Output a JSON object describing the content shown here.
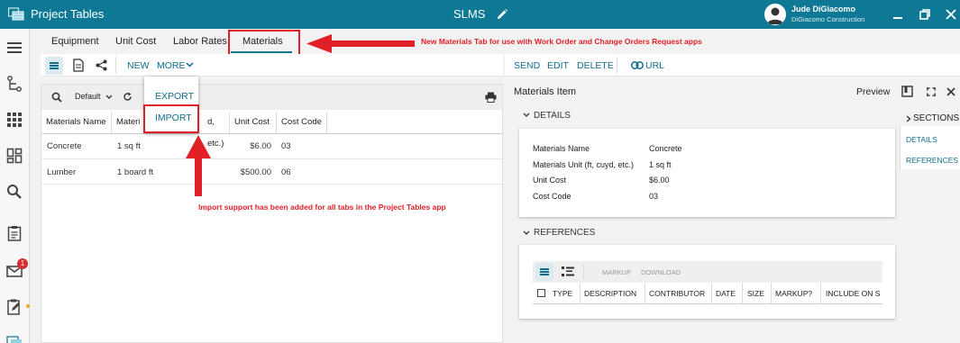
{
  "app": {
    "title": "Project Tables",
    "center_title": "SLMS"
  },
  "user": {
    "name": "Jude DiGiacomo",
    "company": "DiGiacomo Construction"
  },
  "rail": {
    "mail_badge": "1"
  },
  "tabs": [
    {
      "label": "Equipment"
    },
    {
      "label": "Unit Cost"
    },
    {
      "label": "Labor Rates"
    },
    {
      "label": "Materials"
    }
  ],
  "annotations": {
    "tab_note": "New Materials Tab for use with Work Order and Change Orders Request apps",
    "import_note": "Import support has been added for all tabs in the Project Tables app"
  },
  "toolbar": {
    "new_label": "NEW",
    "more_label": "MORE"
  },
  "dropdown": {
    "export_label": "EXPORT",
    "import_label": "IMPORT"
  },
  "grid": {
    "view_label": "Default",
    "columns": [
      "Materials Name",
      "Materi",
      "d, etc.)",
      "Unit Cost",
      "Cost Code"
    ],
    "rows": [
      {
        "name": "Concrete",
        "unit": "1 sq ft",
        "cost": "$6.00",
        "code": "03"
      },
      {
        "name": "Lumber",
        "unit": "1 board ft",
        "cost": "$500.00",
        "code": "06"
      }
    ]
  },
  "detail_toolbar": {
    "send": "SEND",
    "edit": "EDIT",
    "delete": "DELETE",
    "url": "URL"
  },
  "detail": {
    "header": "Materials Item",
    "preview": "Preview",
    "details_title": "DETAILS",
    "fields": [
      {
        "label": "Materials Name",
        "value": "Concrete"
      },
      {
        "label": "Materials Unit (ft, cuyd, etc.)",
        "value": "1 sq ft"
      },
      {
        "label": "Unit Cost",
        "value": "$6.00"
      },
      {
        "label": "Cost Code",
        "value": "03"
      }
    ],
    "references_title": "REFERENCES",
    "ref_actions": {
      "markup": "MARKUP",
      "download": "DOWNLOAD"
    },
    "ref_columns": [
      "TYPE",
      "DESCRIPTION",
      "CONTRIBUTOR",
      "DATE",
      "SIZE",
      "MARKUP?",
      "INCLUDE ON S"
    ]
  },
  "sections": {
    "title": "SECTIONS",
    "items": [
      "DETAILS",
      "REFERENCES"
    ]
  }
}
